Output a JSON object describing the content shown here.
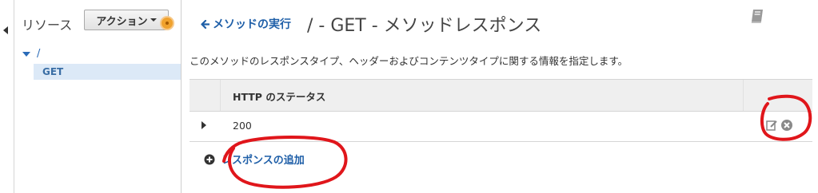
{
  "sidebar": {
    "title": "リソース",
    "action_button": "アクション",
    "tree": {
      "root_label": "/",
      "method_label": "GET"
    }
  },
  "main": {
    "back_link": "メソッドの実行",
    "title": "/ - GET - メソッドレスポンス",
    "description": "このメソッドのレスポンスタイプ、ヘッダーおよびコンテンツタイプに関する情報を指定します。",
    "table": {
      "columns": [
        "HTTP のステータス"
      ],
      "rows": [
        {
          "status": "200"
        }
      ]
    },
    "add_response_label": "レスポンスの追加"
  },
  "icons": {
    "back": "arrow-left-icon",
    "help": "book-icon",
    "edit": "edit-icon",
    "remove": "remove-circle-icon",
    "add": "plus-circle-icon"
  },
  "colors": {
    "link": "#1f5fa8",
    "selected_bg": "#dce9f7",
    "header_bg": "#efefef",
    "accent_orange": "#f0a22e",
    "annotation_red": "#e0161b"
  }
}
